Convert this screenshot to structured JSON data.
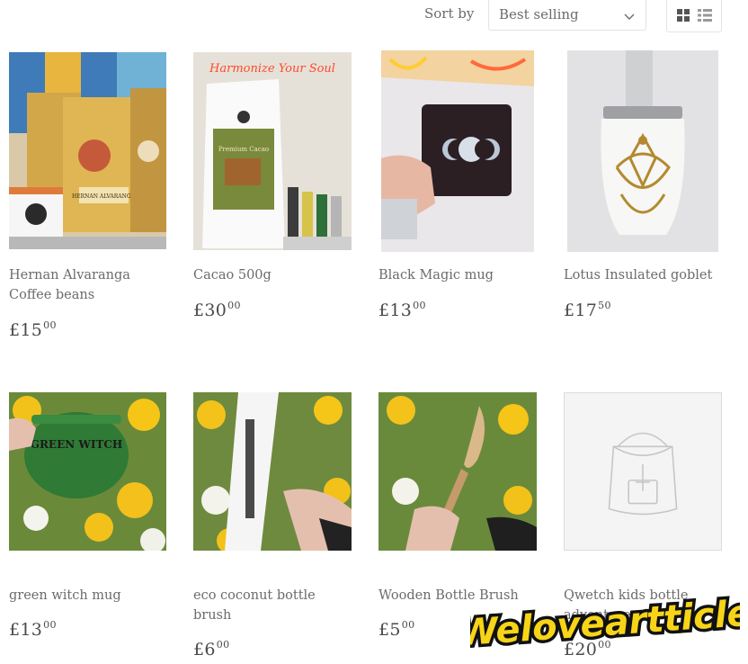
{
  "toolbar": {
    "sort_label": "Sort by",
    "sort_value": "Best selling"
  },
  "products": [
    {
      "title": "Hernan Alvaranga Coffee beans",
      "price_main": "£15",
      "price_cents": "00"
    },
    {
      "title": "Cacao 500g",
      "price_main": "£30",
      "price_cents": "00"
    },
    {
      "title": "Black Magic mug",
      "price_main": "£13",
      "price_cents": "00"
    },
    {
      "title": "Lotus Insulated goblet",
      "price_main": "£17",
      "price_cents": "50"
    },
    {
      "title": "green witch mug",
      "price_main": "£13",
      "price_cents": "00"
    },
    {
      "title": "eco coconut bottle brush",
      "price_main": "£6",
      "price_cents": "00"
    },
    {
      "title": "Wooden Bottle Brush",
      "price_main": "£5",
      "price_cents": "00"
    },
    {
      "title": "Qwetch kids bottle adventurer",
      "price_main": "£20",
      "price_cents": "00"
    }
  ],
  "image_text": {
    "neon_sign": "Harmonize Your Soul",
    "bag_label": "HERNAN ALVARANGA",
    "cacao_label": "Premium Cacao",
    "witch_mug_text": "GREEN WITCH"
  },
  "watermark": "Weloveartticle"
}
